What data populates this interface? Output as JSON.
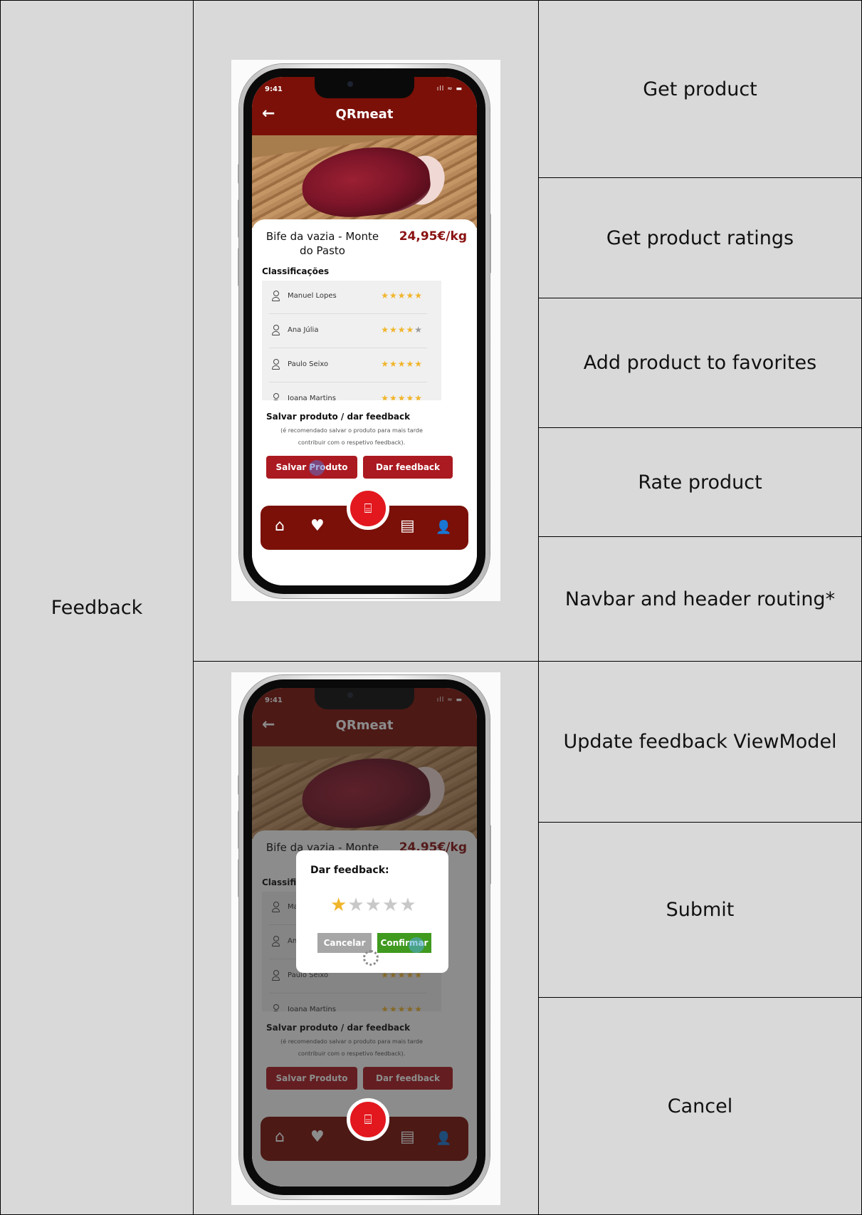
{
  "row_label": "Feedback",
  "features": [
    "Get product",
    "Get product ratings",
    "Add product to favorites",
    "Rate product",
    "Navbar and header routing*",
    "Update feedback ViewModel",
    "Submit",
    "Cancel"
  ],
  "phone": {
    "status_time": "9:41",
    "status_icons": "ıll ≈ ▬",
    "back_arrow": "←",
    "app_title": "QRmeat",
    "product_name": "Bife da vazia - Monte do Pasto",
    "price": "24,95€/kg",
    "ratings_heading": "Classificações",
    "ratings": [
      {
        "name": "Manuel Lopes",
        "stars_on": "★★★★★",
        "stars_off": "",
        "rating": 5
      },
      {
        "name": "Ana Júlia",
        "stars_on": "★★★★",
        "stars_off": "★",
        "rating": 4
      },
      {
        "name": "Paulo Seixo",
        "stars_on": "★★★★★",
        "stars_off": "",
        "rating": 5
      },
      {
        "name": "Joana Martins",
        "stars_on": "★★★★★",
        "stars_off": "",
        "rating": 5
      }
    ],
    "save_title": "Salvar produto / dar feedback",
    "save_subtitle": "(é recomendado salvar o produto para mais tarde contribuir com o respetivo feedback).",
    "save_button": "Salvar Produto",
    "feedback_button": "Dar feedback",
    "scan_icon": "⌸",
    "nav_icons": {
      "home": "⌂",
      "favorites": "♥",
      "news": "▤",
      "profile": "👤"
    }
  },
  "dialog": {
    "title": "Dar feedback:",
    "stars_on": "★",
    "stars_off": "★★★★",
    "selected_rating": 1,
    "cancel": "Cancelar",
    "confirm": "Confirmar"
  },
  "colors": {
    "header": "#7a1008",
    "primary_button": "#ab1a21",
    "scan_button": "#e2181e",
    "star": "#f1b52a",
    "cancel_button": "#a6a6a6",
    "confirm_button": "#3f9a1f",
    "cell_background": "#d9d9d9"
  }
}
